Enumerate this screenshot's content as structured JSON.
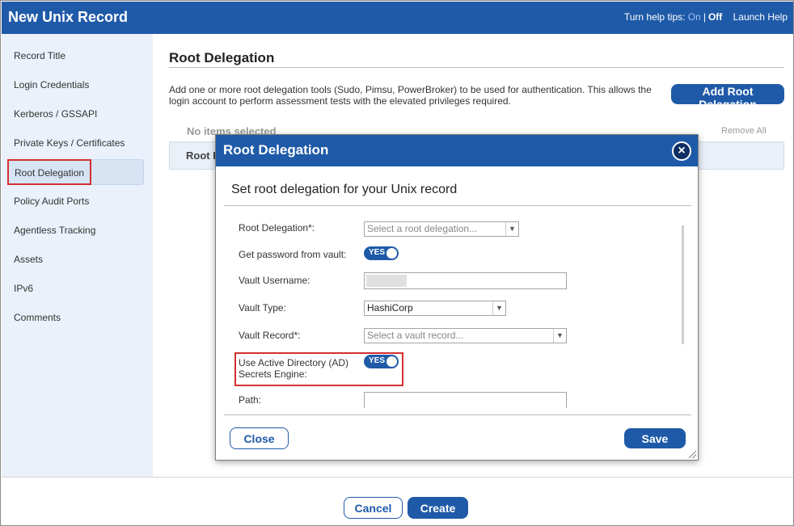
{
  "window": {
    "title": "New Unix Record",
    "help_prefix": "Turn help tips:",
    "help_on": "On",
    "help_sep": "|",
    "help_off": "Off",
    "launch_help": "Launch Help"
  },
  "sidebar": {
    "items": [
      {
        "label": "Record Title"
      },
      {
        "label": "Login Credentials"
      },
      {
        "label": "Kerberos / GSSAPI"
      },
      {
        "label": "Private Keys / Certificates"
      },
      {
        "label": "Root Delegation",
        "active": true
      },
      {
        "label": "Policy Audit Ports"
      },
      {
        "label": "Agentless Tracking"
      },
      {
        "label": "Assets"
      },
      {
        "label": "IPv6"
      },
      {
        "label": "Comments"
      }
    ]
  },
  "main": {
    "title": "Root Delegation",
    "description": "Add one or more root delegation tools (Sudo, Pimsu, PowerBroker) to be used for authentication. This allows the login account to perform assessment tests with the elevated privileges required.",
    "add_button": "Add Root Delegation",
    "no_items": "No items selected",
    "remove_all": "Remove All",
    "list_header": "Root I"
  },
  "footer": {
    "cancel": "Cancel",
    "create": "Create"
  },
  "modal": {
    "title": "Root Delegation",
    "close_icon": "×",
    "subtitle": "Set root delegation for your Unix record",
    "fields": {
      "root_delegation_label": "Root Delegation*:",
      "root_delegation_placeholder": "Select a root delegation...",
      "vault_password_label": "Get password from vault:",
      "vault_password_toggle": "YES",
      "vault_username_label": "Vault Username:",
      "vault_type_label": "Vault Type:",
      "vault_type_value": "HashiCorp",
      "vault_record_label": "Vault Record*:",
      "vault_record_placeholder": "Select a vault record...",
      "ad_engine_label_line1": "Use Active Directory (AD)",
      "ad_engine_label_line2": "Secrets Engine:",
      "ad_engine_toggle": "YES",
      "path_label": "Path:"
    },
    "close_button": "Close",
    "save_button": "Save"
  },
  "colors": {
    "brand_blue": "#1f5aa8",
    "highlight_red": "#d32f2f",
    "sidebar_bg": "#eaf1fa"
  },
  "icons": {
    "dropdown": "chevron-down-icon",
    "modal_close": "close-icon",
    "resize": "resize-grip-icon"
  }
}
